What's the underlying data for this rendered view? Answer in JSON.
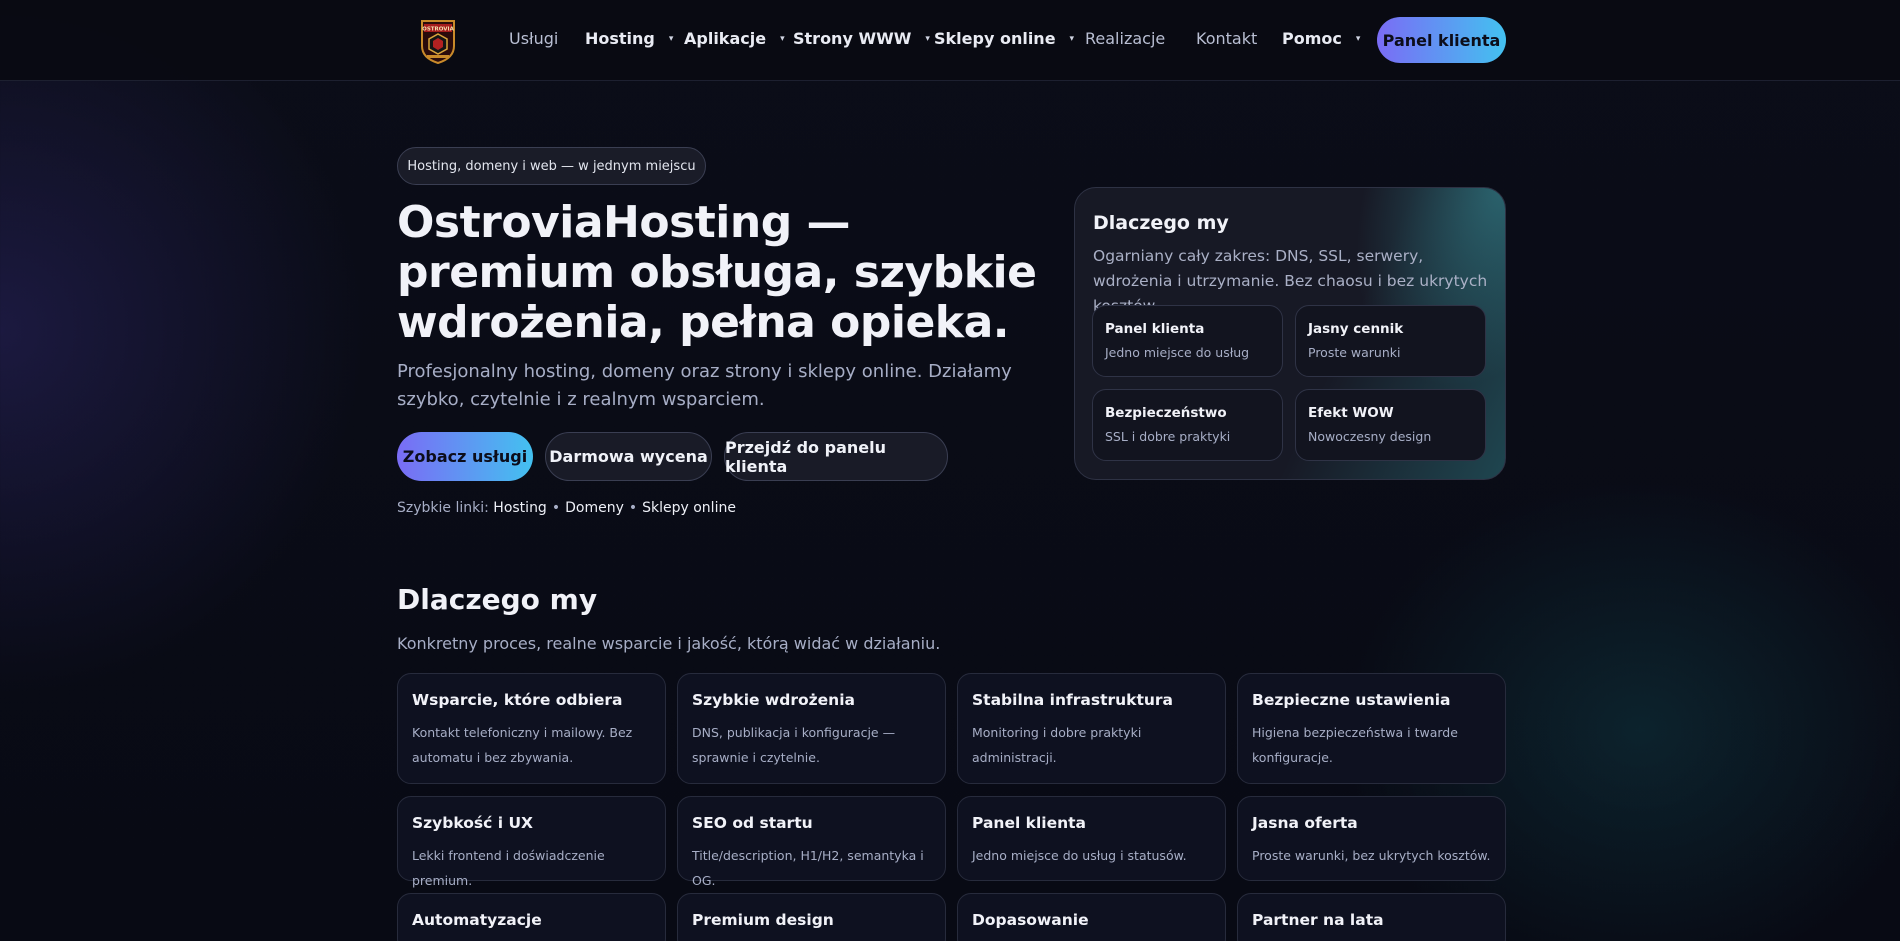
{
  "brand": {
    "logo_text": "OSTROVIA"
  },
  "nav": {
    "items": [
      {
        "label": "Usługi",
        "caret": false
      },
      {
        "label": "Hosting",
        "caret": true
      },
      {
        "label": "Aplikacje",
        "caret": true
      },
      {
        "label": "Strony WWW",
        "caret": true
      },
      {
        "label": "Sklepy online",
        "caret": true
      },
      {
        "label": "Realizacje",
        "caret": false
      },
      {
        "label": "Kontakt",
        "caret": false
      },
      {
        "label": "Pomoc",
        "caret": true
      }
    ],
    "caret_glyph": "▾",
    "cta": "Panel klienta"
  },
  "hero": {
    "pill": "Hosting, domeny i web — w jednym miejscu",
    "title": "OstroviaHosting — premium obsługa, szybkie wdrożenia, pełna opieka.",
    "subtitle": "Profesjonalny hosting, domeny oraz strony i sklepy online. Działamy szybko, czytelnie i z realnym wsparciem.",
    "buttons": [
      "Zobacz usługi",
      "Darmowa wycena",
      "Przejdź do panelu klienta"
    ],
    "quick_prefix": "Szybkie linki:",
    "quick_links": [
      "Hosting",
      "Domeny",
      "Sklepy online"
    ],
    "quick_sep": "•"
  },
  "why_card": {
    "title": "Dlaczego my",
    "text": "Ogarniany cały zakres: DNS, SSL, serwery, wdrożenia i utrzymanie. Bez chaosu i bez ukrytych kosztów.",
    "items": [
      {
        "title": "Panel klienta",
        "desc": "Jedno miejsce do usług"
      },
      {
        "title": "Jasny cennik",
        "desc": "Proste warunki"
      },
      {
        "title": "Bezpieczeństwo",
        "desc": "SSL i dobre praktyki"
      },
      {
        "title": "Efekt WOW",
        "desc": "Nowoczesny design"
      }
    ]
  },
  "section": {
    "title": "Dlaczego my",
    "subtitle": "Konkretny proces, realne wsparcie i jakość, którą widać w działaniu.",
    "features": [
      {
        "title": "Wsparcie, które odbiera",
        "desc": "Kontakt telefoniczny i mailowy. Bez automatu i bez zbywania."
      },
      {
        "title": "Szybkie wdrożenia",
        "desc": "DNS, publikacja i konfiguracje — sprawnie i czytelnie."
      },
      {
        "title": "Stabilna infrastruktura",
        "desc": "Monitoring i dobre praktyki administracji."
      },
      {
        "title": "Bezpieczne ustawienia",
        "desc": "Higiena bezpieczeństwa i twarde konfiguracje."
      },
      {
        "title": "Szybkość i UX",
        "desc": "Lekki frontend i doświadczenie premium."
      },
      {
        "title": "SEO od startu",
        "desc": "Title/description, H1/H2, semantyka i OG."
      },
      {
        "title": "Panel klienta",
        "desc": "Jedno miejsce do usług i statusów."
      },
      {
        "title": "Jasna oferta",
        "desc": "Proste warunki, bez ukrytych kosztów."
      },
      {
        "title": "Automatyzacje",
        "desc": ""
      },
      {
        "title": "Premium design",
        "desc": ""
      },
      {
        "title": "Dopasowanie",
        "desc": ""
      },
      {
        "title": "Partner na lata",
        "desc": ""
      }
    ]
  },
  "colors": {
    "accent_start": "#7a6cf5",
    "accent_end": "#43c1f0",
    "background": "#0a0c16"
  }
}
